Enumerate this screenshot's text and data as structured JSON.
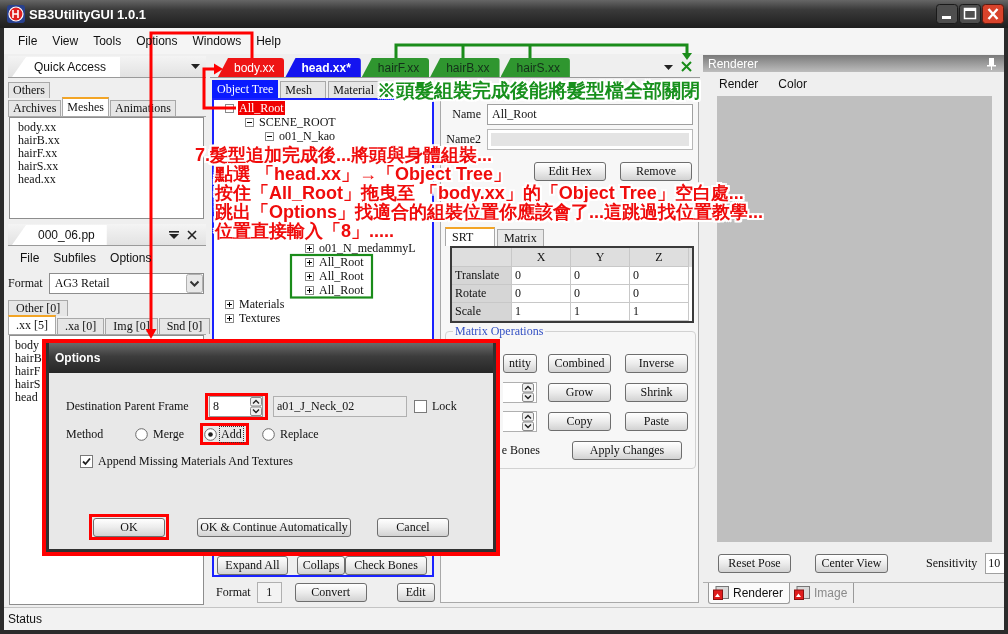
{
  "window": {
    "title": "SB3UtilityGUI 1.0.1"
  },
  "menu": [
    "File",
    "View",
    "Tools",
    "Options",
    "Windows",
    "Help"
  ],
  "quick_access": {
    "title": "Quick Access",
    "tab_rows": [
      [
        {
          "label": "Others",
          "selected": false
        }
      ],
      [
        {
          "label": "Archives",
          "selected": false
        },
        {
          "label": "Meshes",
          "selected": true
        },
        {
          "label": "Animations",
          "selected": false
        }
      ]
    ],
    "items": [
      "body.xx",
      "hairB.xx",
      "hairF.xx",
      "hairS.xx",
      "head.xx"
    ]
  },
  "pp_panel": {
    "title": "000_06.pp",
    "menu": [
      "File",
      "Subfiles",
      "Options"
    ],
    "format": {
      "label": "Format",
      "value": "AG3 Retail"
    },
    "tab_rows": [
      [
        {
          "label": "Other [0]",
          "selected": false
        }
      ],
      [
        {
          "label": ".xx [5]",
          "selected": true
        },
        {
          "label": ".xa [0]",
          "selected": false
        },
        {
          "label": "Img [0]",
          "selected": false
        },
        {
          "label": "Snd [0]",
          "selected": false
        }
      ]
    ],
    "items": [
      "body",
      "hairB",
      "hairF",
      "hairS",
      "head"
    ]
  },
  "documents": {
    "tabs": [
      {
        "label": "body.xx",
        "selected": false,
        "color": "#ee1414"
      },
      {
        "label": "head.xx*",
        "selected": true,
        "color": "#1414f0"
      },
      {
        "label": "hairF.xx",
        "selected": false,
        "color": "#2f962f"
      },
      {
        "label": "hairB.xx",
        "selected": false,
        "color": "#2f962f"
      },
      {
        "label": "hairS.xx",
        "selected": false,
        "color": "#2f962f"
      }
    ]
  },
  "editor_tabs": [
    {
      "label": "Object Tree",
      "selected": true
    },
    {
      "label": "Mesh",
      "selected": false
    },
    {
      "label": "Material",
      "selected": false
    }
  ],
  "tree": [
    {
      "label": "All_Root",
      "expanded": true,
      "selected": true,
      "children": [
        {
          "label": "SCENE_ROOT",
          "expanded": true,
          "selected": false,
          "children": [
            {
              "label": "o01_N_kao",
              "expanded": true,
              "selected": false,
              "children": [
                {
                  "children": [
                    {
                      "label": "o01_N_medammyL",
                      "expanded": false,
                      "selected": false
                    },
                    {
                      "label": "All_Root",
                      "expanded": false,
                      "selected": false
                    },
                    {
                      "label": "All_Root",
                      "expanded": false,
                      "selected": false
                    },
                    {
                      "label": "All_Root",
                      "expanded": false,
                      "selected": false
                    }
                  ]
                }
              ]
            }
          ]
        }
      ]
    },
    {
      "label": "Materials",
      "expanded": false,
      "selected": false
    },
    {
      "label": "Textures",
      "expanded": false,
      "selected": false
    }
  ],
  "tree_buttons": [
    "Expand All",
    "Collaps",
    "Check Bones"
  ],
  "format": {
    "label": "Format",
    "value": "1"
  },
  "bottom_buttons": [
    "Convert",
    "Edit"
  ],
  "properties": {
    "name": {
      "label": "Name",
      "value": "All_Root"
    },
    "name2": {
      "label": "Name2"
    },
    "buttons": [
      "Edit Hex",
      "Remove"
    ],
    "tabs": [
      {
        "label": "SRT",
        "selected": true
      },
      {
        "label": "Matrix",
        "selected": false
      }
    ],
    "table": {
      "columns": [
        "X",
        "Y",
        "Z"
      ],
      "rows": [
        {
          "label": "Translate",
          "values": [
            "0",
            "0",
            "0"
          ]
        },
        {
          "label": "Rotate",
          "values": [
            "0",
            "0",
            "0"
          ]
        },
        {
          "label": "Scale",
          "values": [
            "1",
            "1",
            "1"
          ]
        }
      ]
    },
    "matrix_operations": {
      "title": "Matrix Operations",
      "rows": [
        {
          "lead": {
            "kind": "button",
            "label": "ntity"
          },
          "buttons": [
            "Combined",
            "Inverse"
          ]
        },
        {
          "lead": {
            "kind": "spinner"
          },
          "buttons": [
            "Grow",
            "Shrink"
          ]
        },
        {
          "lead": {
            "kind": "spinner"
          },
          "buttons": [
            "Copy",
            "Paste"
          ]
        },
        {
          "lead": {
            "kind": "text",
            "label": "e Bones"
          },
          "buttons": [
            "Apply Changes"
          ]
        }
      ]
    }
  },
  "renderer": {
    "title": "Renderer",
    "menu": [
      "Render",
      "Color"
    ],
    "buttons": [
      "Reset Pose",
      "Center View"
    ],
    "sensitivity": {
      "label": "Sensitivity",
      "value": "10"
    },
    "tabs": [
      {
        "label": "Renderer",
        "selected": true
      },
      {
        "label": "Image",
        "selected": false
      }
    ]
  },
  "status_bar": "Status",
  "options_dialog": {
    "title": "Options",
    "destination": {
      "label": "Destination Parent Frame",
      "value": "8"
    },
    "frame_name": "a01_J_Neck_02",
    "lock": {
      "label": "Lock",
      "checked": false
    },
    "method_label": "Method",
    "methods": [
      {
        "label": "Merge",
        "selected": false
      },
      {
        "label": "Add",
        "selected": true
      },
      {
        "label": "Replace",
        "selected": false
      }
    ],
    "append": {
      "label": "Append Missing Materials And Textures",
      "checked": true
    },
    "buttons": [
      "OK",
      "OK & Continue Automatically",
      "Cancel"
    ]
  },
  "annotations": {
    "note": "※頭髮組裝完成後能將髮型檔全部關閉",
    "steps": [
      "7.髮型追加完成後...將頭與身體組裝...",
      "點選 「head.xx」→「Object Tree」",
      "按住「All_Root」拖曳至 「body.xx」的「Object Tree」空白處...",
      "跳出「Options」找適合的組裝位置你應該會了...這跳過找位置教學...",
      "位置直接輸入「8」....."
    ]
  }
}
